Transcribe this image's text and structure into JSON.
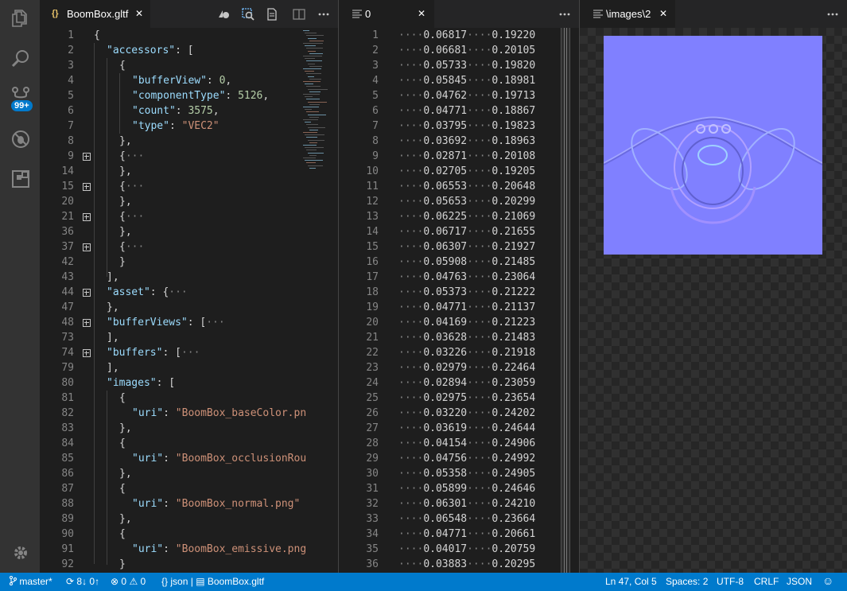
{
  "activity_bar": {
    "items": [
      {
        "icon": "explorer-icon"
      },
      {
        "icon": "search-icon"
      },
      {
        "icon": "source-control-icon"
      },
      {
        "icon": "debug-icon"
      },
      {
        "icon": "extensions-icon"
      }
    ],
    "scm_badge": "99+",
    "settings_icon": "gear-icon"
  },
  "editor1": {
    "tab": {
      "icon_text": "{}",
      "title": "BoomBox.gltf",
      "close": "✕"
    },
    "toolbar": [
      "preview-model-icon",
      "inspect-icon",
      "open-preview-icon",
      "split-editor-icon",
      "more-icon"
    ],
    "lines": [
      {
        "n": "1",
        "fold": false,
        "indent": 0,
        "parts": [
          [
            "p",
            "{"
          ]
        ]
      },
      {
        "n": "2",
        "fold": false,
        "indent": 1,
        "parts": [
          [
            "k",
            "\"accessors\""
          ],
          [
            "p",
            ": ["
          ]
        ]
      },
      {
        "n": "3",
        "fold": false,
        "indent": 2,
        "parts": [
          [
            "p",
            "{"
          ]
        ]
      },
      {
        "n": "4",
        "fold": false,
        "indent": 3,
        "parts": [
          [
            "k",
            "\"bufferView\""
          ],
          [
            "p",
            ": "
          ],
          [
            "n",
            "0"
          ],
          [
            "p",
            ","
          ]
        ]
      },
      {
        "n": "5",
        "fold": false,
        "indent": 3,
        "parts": [
          [
            "k",
            "\"componentType\""
          ],
          [
            "p",
            ": "
          ],
          [
            "n",
            "5126"
          ],
          [
            "p",
            ","
          ]
        ]
      },
      {
        "n": "6",
        "fold": false,
        "indent": 3,
        "parts": [
          [
            "k",
            "\"count\""
          ],
          [
            "p",
            ": "
          ],
          [
            "n",
            "3575"
          ],
          [
            "p",
            ","
          ]
        ]
      },
      {
        "n": "7",
        "fold": false,
        "indent": 3,
        "parts": [
          [
            "k",
            "\"type\""
          ],
          [
            "p",
            ": "
          ],
          [
            "s",
            "\"VEC2\""
          ]
        ]
      },
      {
        "n": "8",
        "fold": false,
        "indent": 2,
        "parts": [
          [
            "p",
            "},"
          ]
        ]
      },
      {
        "n": "9",
        "fold": true,
        "indent": 2,
        "parts": [
          [
            "p",
            "{"
          ],
          [
            "dots",
            "···"
          ]
        ]
      },
      {
        "n": "14",
        "fold": false,
        "indent": 2,
        "parts": [
          [
            "p",
            "},"
          ]
        ]
      },
      {
        "n": "15",
        "fold": true,
        "indent": 2,
        "parts": [
          [
            "p",
            "{"
          ],
          [
            "dots",
            "···"
          ]
        ]
      },
      {
        "n": "20",
        "fold": false,
        "indent": 2,
        "parts": [
          [
            "p",
            "},"
          ]
        ]
      },
      {
        "n": "21",
        "fold": true,
        "indent": 2,
        "parts": [
          [
            "p",
            "{"
          ],
          [
            "dots",
            "···"
          ]
        ]
      },
      {
        "n": "36",
        "fold": false,
        "indent": 2,
        "parts": [
          [
            "p",
            "},"
          ]
        ]
      },
      {
        "n": "37",
        "fold": true,
        "indent": 2,
        "parts": [
          [
            "p",
            "{"
          ],
          [
            "dots",
            "···"
          ]
        ]
      },
      {
        "n": "42",
        "fold": false,
        "indent": 2,
        "parts": [
          [
            "p",
            "}"
          ]
        ]
      },
      {
        "n": "43",
        "fold": false,
        "indent": 1,
        "parts": [
          [
            "p",
            "],"
          ]
        ]
      },
      {
        "n": "44",
        "fold": true,
        "indent": 1,
        "parts": [
          [
            "k",
            "\"asset\""
          ],
          [
            "p",
            ": {"
          ],
          [
            "dots",
            "···"
          ]
        ]
      },
      {
        "n": "47",
        "fold": false,
        "indent": 1,
        "parts": [
          [
            "p",
            "},"
          ]
        ]
      },
      {
        "n": "48",
        "fold": true,
        "indent": 1,
        "parts": [
          [
            "k",
            "\"bufferViews\""
          ],
          [
            "p",
            ": ["
          ],
          [
            "dots",
            "···"
          ]
        ]
      },
      {
        "n": "73",
        "fold": false,
        "indent": 1,
        "parts": [
          [
            "p",
            "],"
          ]
        ]
      },
      {
        "n": "74",
        "fold": true,
        "indent": 1,
        "parts": [
          [
            "k",
            "\"buffers\""
          ],
          [
            "p",
            ": ["
          ],
          [
            "dots",
            "···"
          ]
        ]
      },
      {
        "n": "79",
        "fold": false,
        "indent": 1,
        "parts": [
          [
            "p",
            "],"
          ]
        ]
      },
      {
        "n": "80",
        "fold": false,
        "indent": 1,
        "parts": [
          [
            "k",
            "\"images\""
          ],
          [
            "p",
            ": ["
          ]
        ]
      },
      {
        "n": "81",
        "fold": false,
        "indent": 2,
        "parts": [
          [
            "p",
            "{"
          ]
        ]
      },
      {
        "n": "82",
        "fold": false,
        "indent": 3,
        "parts": [
          [
            "k",
            "\"uri\""
          ],
          [
            "p",
            ": "
          ],
          [
            "s",
            "\"BoomBox_baseColor.pn"
          ]
        ]
      },
      {
        "n": "83",
        "fold": false,
        "indent": 2,
        "parts": [
          [
            "p",
            "},"
          ]
        ]
      },
      {
        "n": "84",
        "fold": false,
        "indent": 2,
        "parts": [
          [
            "p",
            "{"
          ]
        ]
      },
      {
        "n": "85",
        "fold": false,
        "indent": 3,
        "parts": [
          [
            "k",
            "\"uri\""
          ],
          [
            "p",
            ": "
          ],
          [
            "s",
            "\"BoomBox_occlusionRou"
          ]
        ]
      },
      {
        "n": "86",
        "fold": false,
        "indent": 2,
        "parts": [
          [
            "p",
            "},"
          ]
        ]
      },
      {
        "n": "87",
        "fold": false,
        "indent": 2,
        "parts": [
          [
            "p",
            "{"
          ]
        ]
      },
      {
        "n": "88",
        "fold": false,
        "indent": 3,
        "parts": [
          [
            "k",
            "\"uri\""
          ],
          [
            "p",
            ": "
          ],
          [
            "s",
            "\"BoomBox_normal.png\""
          ]
        ]
      },
      {
        "n": "89",
        "fold": false,
        "indent": 2,
        "parts": [
          [
            "p",
            "},"
          ]
        ]
      },
      {
        "n": "90",
        "fold": false,
        "indent": 2,
        "parts": [
          [
            "p",
            "{"
          ]
        ]
      },
      {
        "n": "91",
        "fold": false,
        "indent": 3,
        "parts": [
          [
            "k",
            "\"uri\""
          ],
          [
            "p",
            ": "
          ],
          [
            "s",
            "\"BoomBox_emissive.png"
          ]
        ]
      },
      {
        "n": "92",
        "fold": false,
        "indent": 2,
        "parts": [
          [
            "p",
            "}"
          ]
        ]
      }
    ]
  },
  "editor2": {
    "tab": {
      "title": "0",
      "close": "✕"
    },
    "rows": [
      [
        "1",
        "0.06817",
        "0.19220"
      ],
      [
        "2",
        "0.06681",
        "0.20105"
      ],
      [
        "3",
        "0.05733",
        "0.19820"
      ],
      [
        "4",
        "0.05845",
        "0.18981"
      ],
      [
        "5",
        "0.04762",
        "0.19713"
      ],
      [
        "6",
        "0.04771",
        "0.18867"
      ],
      [
        "7",
        "0.03795",
        "0.19823"
      ],
      [
        "8",
        "0.03692",
        "0.18963"
      ],
      [
        "9",
        "0.02871",
        "0.20108"
      ],
      [
        "10",
        "0.02705",
        "0.19205"
      ],
      [
        "11",
        "0.06553",
        "0.20648"
      ],
      [
        "12",
        "0.05653",
        "0.20299"
      ],
      [
        "13",
        "0.06225",
        "0.21069"
      ],
      [
        "14",
        "0.06717",
        "0.21655"
      ],
      [
        "15",
        "0.06307",
        "0.21927"
      ],
      [
        "16",
        "0.05908",
        "0.21485"
      ],
      [
        "17",
        "0.04763",
        "0.23064"
      ],
      [
        "18",
        "0.05373",
        "0.21222"
      ],
      [
        "19",
        "0.04771",
        "0.21137"
      ],
      [
        "20",
        "0.04169",
        "0.21223"
      ],
      [
        "21",
        "0.03628",
        "0.21483"
      ],
      [
        "22",
        "0.03226",
        "0.21918"
      ],
      [
        "23",
        "0.02979",
        "0.22464"
      ],
      [
        "24",
        "0.02894",
        "0.23059"
      ],
      [
        "25",
        "0.02975",
        "0.23654"
      ],
      [
        "26",
        "0.03220",
        "0.24202"
      ],
      [
        "27",
        "0.03619",
        "0.24644"
      ],
      [
        "28",
        "0.04154",
        "0.24906"
      ],
      [
        "29",
        "0.04756",
        "0.24992"
      ],
      [
        "30",
        "0.05358",
        "0.24905"
      ],
      [
        "31",
        "0.05899",
        "0.24646"
      ],
      [
        "32",
        "0.06301",
        "0.24210"
      ],
      [
        "33",
        "0.06548",
        "0.23664"
      ],
      [
        "34",
        "0.04771",
        "0.20661"
      ],
      [
        "35",
        "0.04017",
        "0.20759"
      ],
      [
        "36",
        "0.03883",
        "0.20295"
      ]
    ]
  },
  "editor3": {
    "tab": {
      "title": "\\images\\2",
      "close": "✕"
    },
    "image_color": "#8080ff"
  },
  "status_bar": {
    "branch": "master*",
    "sync": "8↓ 0↑",
    "errors": "0",
    "warnings": "0",
    "language_mode_short": "json",
    "file": "BoomBox.gltf",
    "position": "Ln 47, Col 5",
    "spaces": "Spaces: 2",
    "encoding": "UTF-8",
    "eol": "CRLF",
    "language": "JSON"
  },
  "colors": {
    "accent": "#007acc",
    "string": "#ce9178",
    "key": "#9cdcfe",
    "number": "#b5cea8"
  }
}
